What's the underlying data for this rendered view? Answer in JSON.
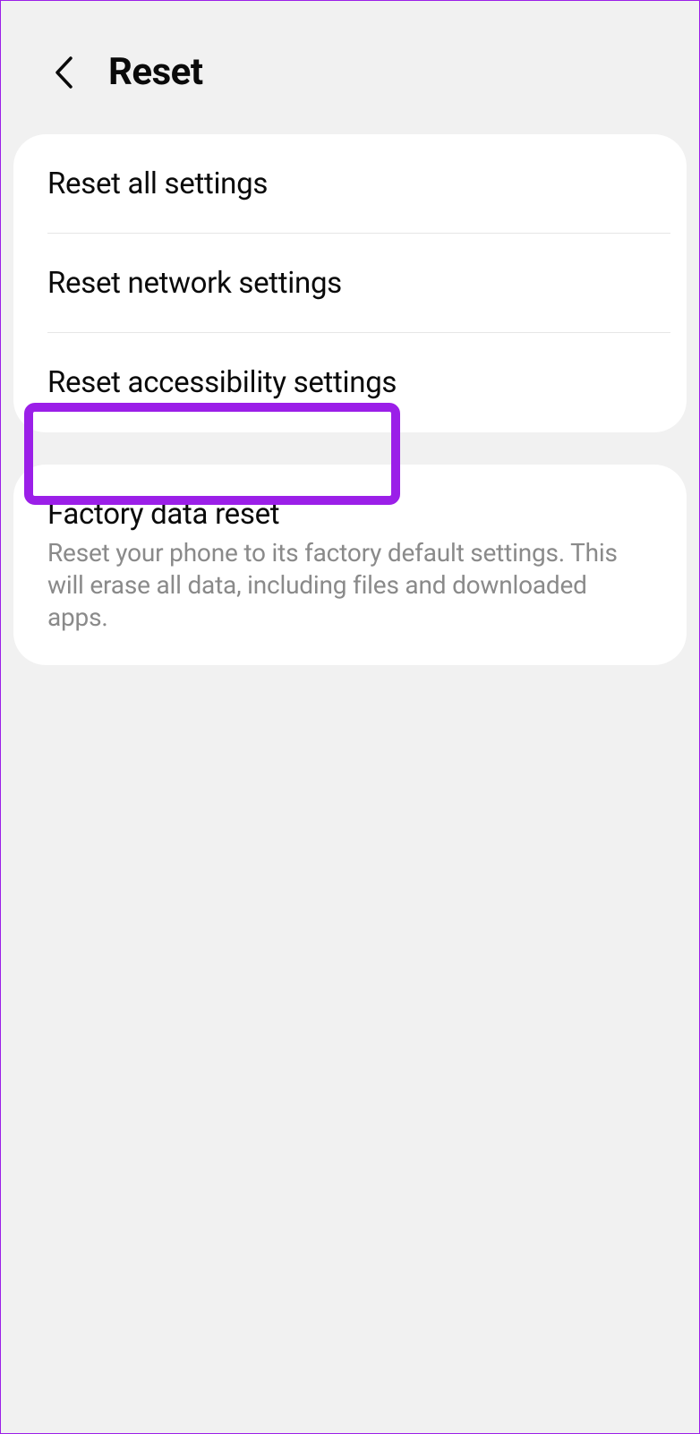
{
  "header": {
    "title": "Reset"
  },
  "group1": {
    "items": [
      {
        "label": "Reset all settings"
      },
      {
        "label": "Reset network settings"
      },
      {
        "label": "Reset accessibility settings"
      }
    ]
  },
  "group2": {
    "items": [
      {
        "label": "Factory data reset",
        "description": "Reset your phone to its factory default settings. This will erase all data, including files and downloaded apps."
      }
    ]
  }
}
